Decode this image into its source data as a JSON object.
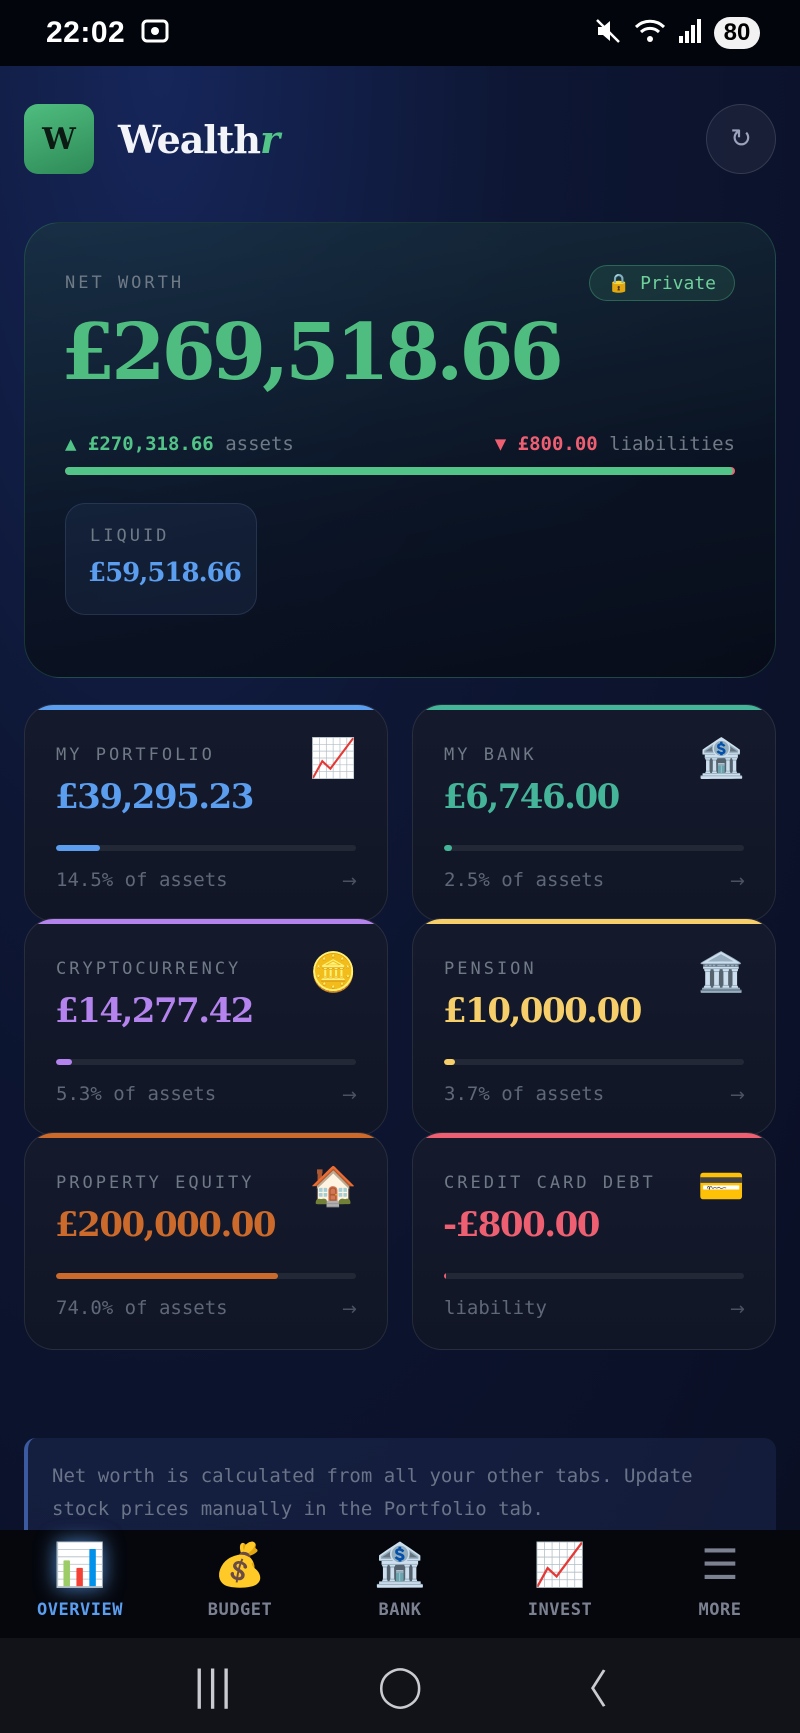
{
  "status_bar": {
    "time": "22:02",
    "battery": "80"
  },
  "header": {
    "logo_letter": "W",
    "brand_main": "Wealth",
    "brand_accent": "r",
    "refresh_icon": "↻"
  },
  "net_worth": {
    "label": "NET WORTH",
    "badge": "Private",
    "badge_icon": "🔒",
    "value": "£269,518.66",
    "assets_arrow": "▲",
    "assets_value": "£270,318.66",
    "assets_label": "assets",
    "liabilities_arrow": "▼",
    "liabilities_value": "£800.00",
    "liabilities_label": "liabilities",
    "assets_share": 0.997,
    "liquid_label": "LIQUID",
    "liquid_value": "£59,518.66"
  },
  "tiles": [
    {
      "label": "MY PORTFOLIO",
      "icon": "📈",
      "value": "£39,295.23",
      "share": 0.145,
      "sub": "14.5% of assets",
      "arrow": "→",
      "color": "#5b9ef0"
    },
    {
      "label": "MY BANK",
      "icon": "🏦",
      "value": "£6,746.00",
      "share": 0.025,
      "sub": "2.5% of assets",
      "arrow": "→",
      "color": "#45b59a"
    },
    {
      "label": "CRYPTOCURRENCY",
      "icon": "🪙",
      "value": "£14,277.42",
      "share": 0.053,
      "sub": "5.3% of assets",
      "arrow": "→",
      "color": "#b483ee"
    },
    {
      "label": "PENSION",
      "icon": "🏛️",
      "value": "£10,000.00",
      "share": 0.037,
      "sub": "3.7% of assets",
      "arrow": "→",
      "color": "#f6cf6b"
    },
    {
      "label": "PROPERTY EQUITY",
      "icon": "🏠",
      "value": "£200,000.00",
      "share": 0.74,
      "sub": "74.0% of assets",
      "arrow": "→",
      "color": "#cc6a2c"
    },
    {
      "label": "CREDIT CARD DEBT",
      "icon": "💳",
      "value": "-£800.00",
      "share": 0.003,
      "sub": "liability",
      "arrow": "→",
      "color": "#ef5f72"
    }
  ],
  "note": "Net worth is calculated from all your other tabs. Update stock prices manually in the Portfolio tab.",
  "nav": [
    {
      "label": "OVERVIEW",
      "icon": "📊"
    },
    {
      "label": "BUDGET",
      "icon": "💰"
    },
    {
      "label": "BANK",
      "icon": "🏦"
    },
    {
      "label": "INVEST",
      "icon": "📈"
    },
    {
      "label": "MORE",
      "icon": "☰"
    }
  ],
  "system_nav": {
    "recents": "|||",
    "home": "◯",
    "back": "〈"
  }
}
